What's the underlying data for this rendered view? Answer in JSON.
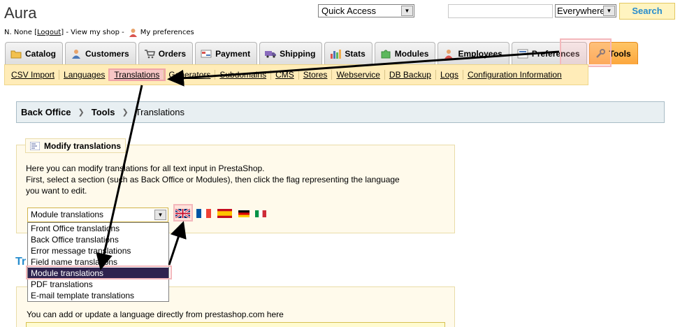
{
  "header": {
    "shop_name": "Aura",
    "user_name": "N. None",
    "logout_open": "[",
    "logout_label": "Logout",
    "logout_close": "]",
    "view_shop_label": "- View my shop -",
    "preferences_label": "My preferences"
  },
  "quick_access": {
    "selected": "Quick Access"
  },
  "search": {
    "value": "",
    "scope": "Everywhere",
    "button_label": "Search"
  },
  "tabs": [
    {
      "label": "Catalog",
      "icon": "folder-icon"
    },
    {
      "label": "Customers",
      "icon": "customers-icon"
    },
    {
      "label": "Orders",
      "icon": "cart-icon"
    },
    {
      "label": "Payment",
      "icon": "payment-icon"
    },
    {
      "label": "Shipping",
      "icon": "truck-icon"
    },
    {
      "label": "Stats",
      "icon": "stats-icon"
    },
    {
      "label": "Modules",
      "icon": "puzzle-icon"
    },
    {
      "label": "Employees",
      "icon": "employees-icon"
    },
    {
      "label": "Preferences",
      "icon": "preferences-icon"
    },
    {
      "label": "Tools",
      "icon": "wrench-icon",
      "active": true
    }
  ],
  "subnav": [
    {
      "label": "CSV Import"
    },
    {
      "label": "Languages"
    },
    {
      "label": "Translations",
      "selected": true
    },
    {
      "label": "Generators"
    },
    {
      "label": "Subdomains"
    },
    {
      "label": "CMS"
    },
    {
      "label": "Stores"
    },
    {
      "label": "Webservice"
    },
    {
      "label": "DB Backup"
    },
    {
      "label": "Logs"
    },
    {
      "label": "Configuration Information"
    }
  ],
  "breadcrumb": {
    "level1": "Back Office",
    "level2": "Tools",
    "level3": "Translations",
    "separator": "❯"
  },
  "modify": {
    "title": "Modify translations",
    "line1": "Here you can modify translations for all text input in PrestaShop.",
    "line2": "First, select a section (such as Back Office or Modules), then click the flag representing the language",
    "line3": "you want to edit.",
    "select_value": "Module translations",
    "options": [
      "Front Office translations",
      "Back Office translations",
      "Error message translations",
      "Field name translations",
      "Module translations",
      "PDF translations",
      "E-mail template translations"
    ],
    "selected_index": 4,
    "flags": [
      "flag-uk-icon",
      "flag-france-icon",
      "flag-spain-icon",
      "flag-germany-icon",
      "flag-italy-icon"
    ]
  },
  "translations_heading": "Tr",
  "add_update": {
    "text": "You can add or update a language directly from prestashop.com here"
  },
  "colors": {
    "accent_blue": "#268ccd",
    "active_tab": "#fca73d",
    "subnav_bg": "#ffecb8",
    "highlight_pink": "#f4b8bc",
    "selected_option": "#2e234f"
  }
}
